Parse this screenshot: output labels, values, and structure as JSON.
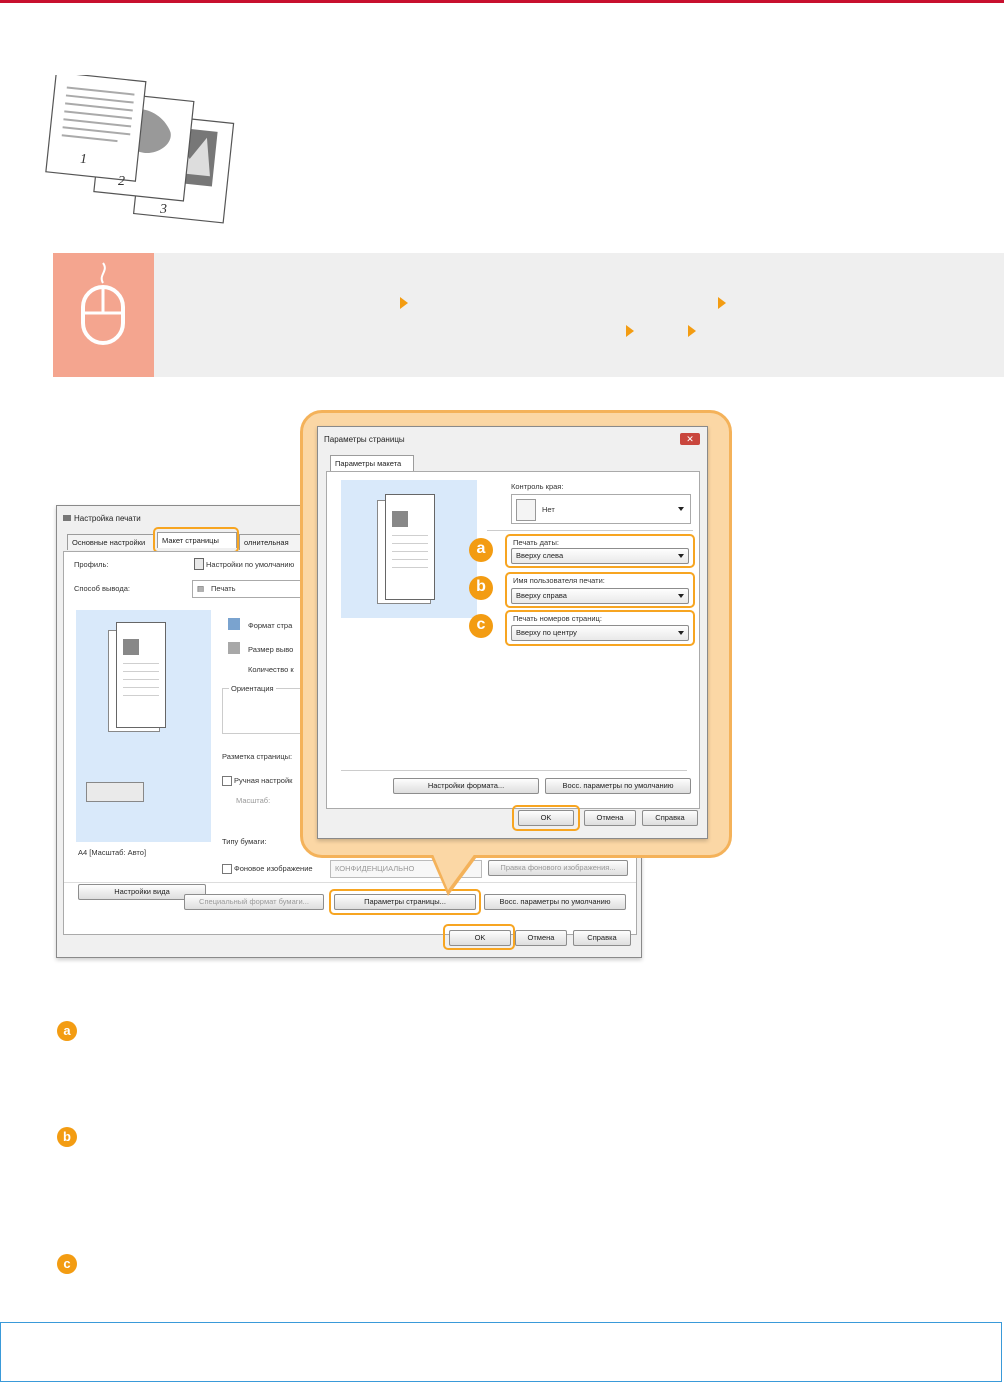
{
  "colors": {
    "accent": "#f39c12",
    "top_rule": "#c8102e",
    "highlight": "#f7a521",
    "bubble": "#fbd7a5"
  },
  "illustration": {
    "page_numbers": [
      "1",
      "2",
      "3"
    ]
  },
  "instruction": {
    "icon": "mouse-icon"
  },
  "print_settings": {
    "title": "Настройка печати",
    "tabs": [
      "Основные настройки",
      "Макет страницы",
      "Дополнительная обработка"
    ],
    "tab_partial_labels": [
      "Основные настройки",
      "Макет страницы",
      "олнительная"
    ],
    "profile_label": "Профиль:",
    "profile_value": "Настройки по умолчанию",
    "output_label": "Способ вывода:",
    "output_value": "Печать",
    "page_size_label": "Формат стра",
    "output_size_label": "Размер выво",
    "copies_label": "Количество к",
    "orientation_label": "Ориентация",
    "page_layout_label": "Разметка страницы:",
    "manual_scale_label": "Ручная настройк",
    "scale_label": "Масштаб:",
    "paper_type_label": "Типу бумаги:",
    "watermark_label": "Фоновое изображение",
    "watermark_value": "КОНФИДЕНЦИАЛЬНО",
    "watermark_edit": "Правка фонового изображения...",
    "preview_caption": "A4 [Масштаб: Авто]",
    "view_settings": "Настройки вида",
    "custom_paper": "Специальный формат бумаги...",
    "page_options": "Параметры страницы...",
    "restore_defaults": "Восс. параметры по умолчанию",
    "ok": "OK",
    "cancel": "Отмена",
    "help": "Справка"
  },
  "page_options": {
    "title": "Параметры страницы",
    "tab": "Параметры макета",
    "edge_label": "Контроль края:",
    "edge_value": "Нет",
    "date_label": "Печать даты:",
    "date_value": "Вверху слева",
    "user_label": "Имя пользователя печати:",
    "user_value": "Вверху справа",
    "page_num_label": "Печать номеров страниц:",
    "page_num_value": "Вверху по центру",
    "format_settings": "Настройки формата...",
    "restore_defaults": "Восс. параметры по умолчанию",
    "ok": "OK",
    "cancel": "Отмена",
    "help": "Справка"
  },
  "markers": [
    "a",
    "b",
    "c"
  ]
}
